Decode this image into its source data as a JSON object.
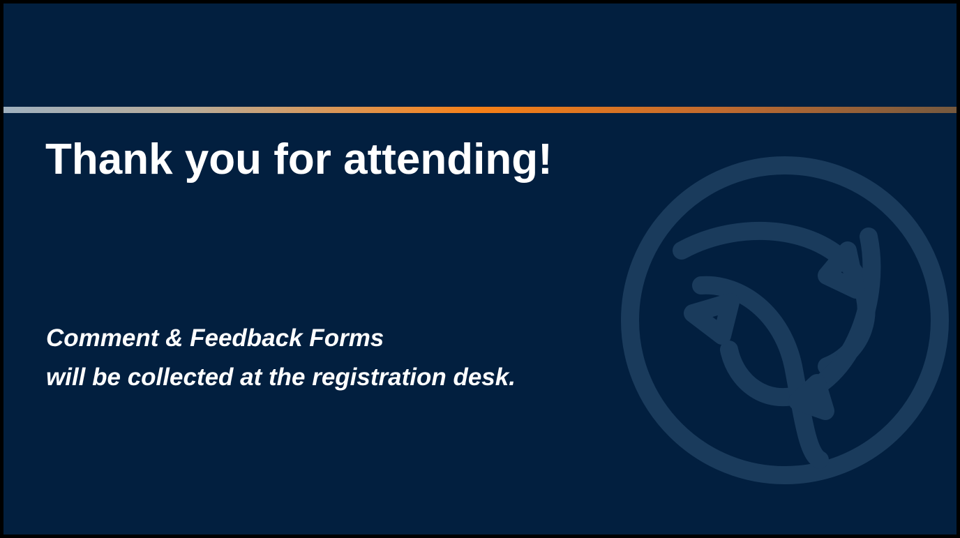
{
  "slide": {
    "title": "Thank you for attending!",
    "body_lines": [
      "Comment & Feedback Forms",
      "will be collected at the registration desk."
    ]
  },
  "colors": {
    "background": "#021f3f",
    "text": "#ffffff",
    "accent": "#f57f17",
    "watermark": "#1a3b5c"
  },
  "icons": {
    "watermark": "trinity-knot-logo-icon"
  }
}
